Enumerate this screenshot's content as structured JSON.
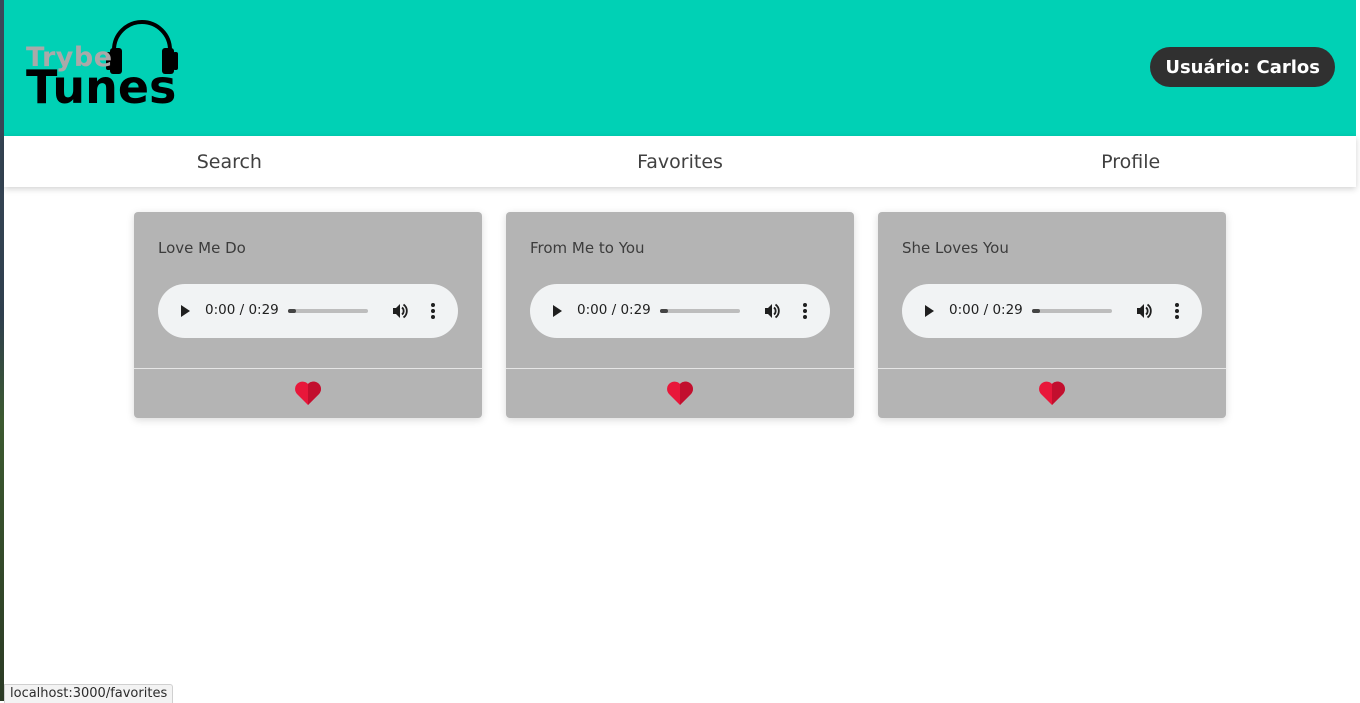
{
  "header": {
    "logo_top": "Trybe",
    "logo_bottom": "Tunes",
    "user_label": "Usuário: Carlos"
  },
  "nav": {
    "items": [
      {
        "label": "Search"
      },
      {
        "label": "Favorites"
      },
      {
        "label": "Profile"
      }
    ]
  },
  "favorites": [
    {
      "track_name": "Love Me Do",
      "time": "0:00 / 0:29",
      "favorited": true
    },
    {
      "track_name": "From Me to You",
      "time": "0:00 / 0:29",
      "favorited": true
    },
    {
      "track_name": "She Loves You",
      "time": "0:00 / 0:29",
      "favorited": true
    }
  ],
  "status_bar": {
    "url": "localhost:3000/favorites"
  },
  "colors": {
    "header_bg": "#00d1b5",
    "card_bg": "#b4b4b4",
    "heart": "#e8173a"
  },
  "icons": [
    "headphones-icon",
    "play-icon",
    "volume-icon",
    "more-vert-icon",
    "heart-icon"
  ]
}
